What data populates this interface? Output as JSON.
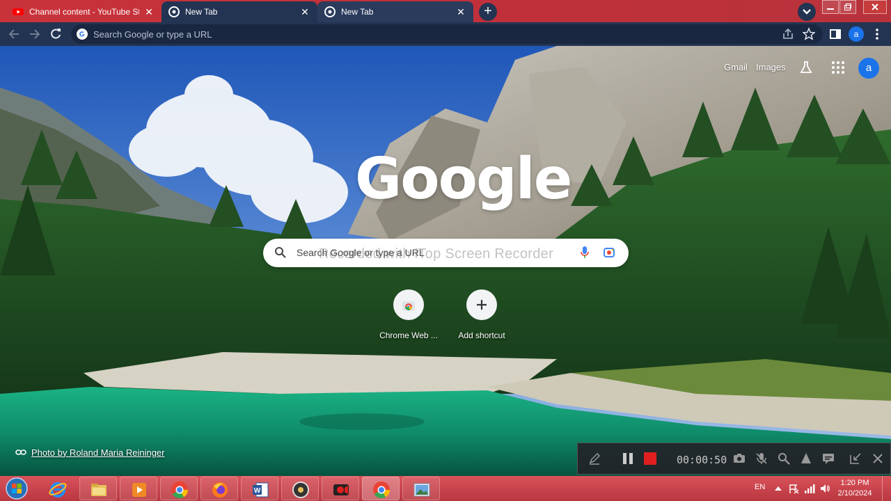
{
  "browser": {
    "tabs": [
      {
        "title": "Channel content - YouTube Studio",
        "favicon": "youtube-icon"
      },
      {
        "title": "New Tab",
        "favicon": "chrome-icon"
      },
      {
        "title": "New Tab",
        "favicon": "chrome-icon"
      }
    ],
    "close_glyph": "✕",
    "omnibox_placeholder": "Search Google or type a URL",
    "profile_initial": "a"
  },
  "new_tab_page": {
    "header_links": {
      "gmail": "Gmail",
      "images": "Images"
    },
    "profile_initial": "a",
    "logo_text": "Google",
    "search_placeholder": "Search Google or type a URL",
    "watermark_text": "Recorded with iTop Screen Recorder",
    "shortcuts": [
      {
        "label": "Chrome Web ...",
        "icon": "chrome-web-store-icon"
      },
      {
        "label": "Add shortcut",
        "icon": "plus-icon"
      }
    ],
    "photo_credit": "Photo by Roland Maria Reininger"
  },
  "recorder": {
    "elapsed": "00:00:50",
    "stop_color": "#e02020"
  },
  "taskbar": {
    "apps": [
      "internet-explorer-icon",
      "file-explorer-icon",
      "media-player-icon",
      "chrome-icon",
      "firefox-icon",
      "word-icon",
      "media-app-icon",
      "screen-recorder-icon",
      "chrome-active-icon",
      "photos-icon"
    ],
    "language": "EN",
    "time": "1:20 PM",
    "date": "2/10/2024"
  },
  "colors": {
    "accent": "#1a73e8",
    "tabbar": "#c8333a",
    "toolbar": "#233452"
  }
}
